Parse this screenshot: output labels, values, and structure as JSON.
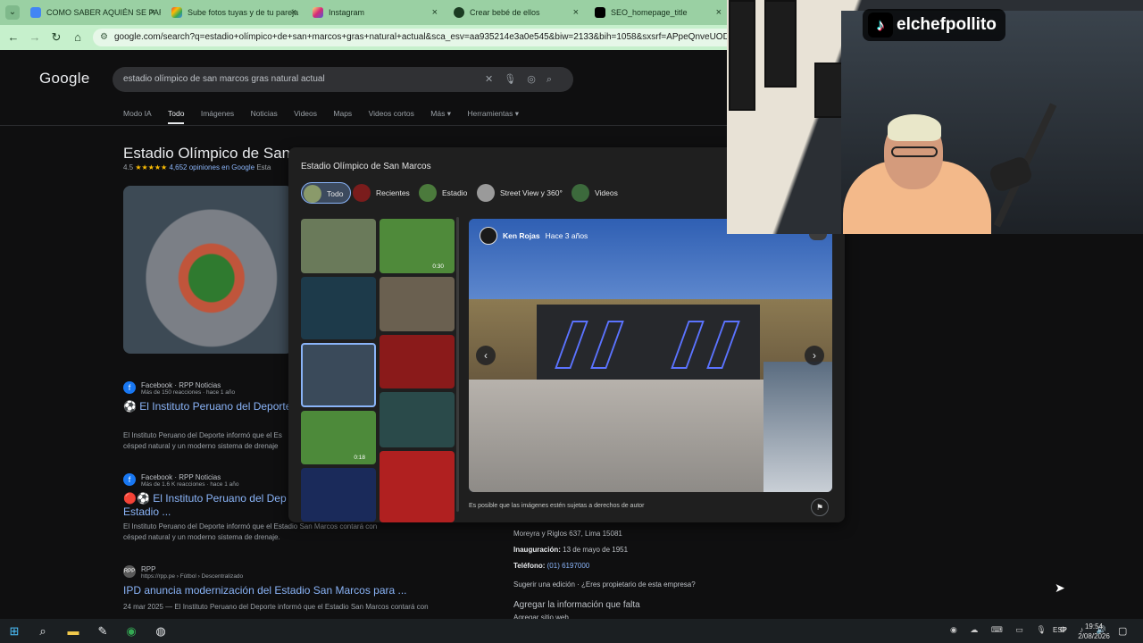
{
  "browser": {
    "tabs": [
      {
        "title": "COMO SABER AQUIÉN SE PAR",
        "favicon": "google-icon",
        "active": false
      },
      {
        "title": "Sube fotos tuyas y de tu pareja",
        "favicon": "gemini-icon",
        "active": false
      },
      {
        "title": "Instagram",
        "favicon": "instagram-icon",
        "active": false
      },
      {
        "title": "Crear bebé de ellos",
        "favicon": "chatgpt-icon",
        "active": false
      },
      {
        "title": "SEO_homepage_title",
        "favicon": "tiktok-icon",
        "active": false
      }
    ],
    "close_glyph": "×",
    "url": "google.com/search?q=estadio+olímpico+de+san+marcos+gras+natural+actual&sca_esv=aa935214e3a0e545&biw=2133&bih=1058&sxsrf=APpeQnveUODh1GHtzM"
  },
  "google": {
    "logo": "Google",
    "query": "estadio olímpico de san marcos gras natural actual",
    "nav": [
      "Modo IA",
      "Todo",
      "Imágenes",
      "Noticias",
      "Videos",
      "Maps",
      "Videos cortos",
      "Más ▾",
      "Herramientas ▾"
    ],
    "active_nav": "Todo",
    "kp_title": "Estadio Olímpico de San",
    "kp_rating_value": "4.5",
    "kp_stars": "★★★★★",
    "kp_reviews": "4,652 opiniones en Google",
    "kp_type": "Esta",
    "results": [
      {
        "icon": "f",
        "source": "Facebook · RPP Noticias",
        "meta": "Más de 150 reacciones · hace 1 año",
        "title": "⚽ El Instituto Peruano del Deporte",
        "snippet_1": "El Instituto Peruano del Deporte informó que el Es",
        "snippet_2": "césped natural y un moderno sistema de drenaje"
      },
      {
        "icon": "f",
        "source": "Facebook · RPP Noticias",
        "meta": "Más de 1.6 K reacciones · hace 1 año",
        "title": "🔴⚽ El Instituto Peruano del Dep",
        "title_2": "Estadio ...",
        "snippet_1": "El Instituto Peruano del Deporte informó que el Estadio San Marcos contará con",
        "snippet_2": "césped natural y un moderno sistema de drenaje."
      },
      {
        "icon": "RPP",
        "source": "RPP",
        "meta": "https://rpp.pe › Fútbol › Descentralizado",
        "title": "IPD anuncia modernización del Estadio San Marcos para ...",
        "snippet_1": "24 mar 2025 — El Instituto Peruano del Deporte informó que el Estadio San Marcos contará con"
      }
    ],
    "info": {
      "address": "Moreyra y Riglos 637, Lima 15081",
      "inauguration_label": "Inauguración:",
      "inauguration_value": "13 de mayo de 1951",
      "phone_label": "Teléfono:",
      "phone_value": "(01) 6197000",
      "suggest": "Sugerir una edición · ¿Eres propietario de esta empresa?",
      "missing": "Agregar la información que falta",
      "add_site": "Agregar sitio web"
    }
  },
  "viewer": {
    "title": "Estadio Olímpico de San Marcos",
    "chips": [
      {
        "label": "Todo",
        "active": true,
        "thumb_color": "#8a9a6a"
      },
      {
        "label": "Recientes",
        "active": false,
        "thumb_color": "#7a1c1c"
      },
      {
        "label": "Estadio",
        "active": false,
        "thumb_color": "#4b7a3c"
      },
      {
        "label": "Street View y 360°",
        "active": false,
        "thumb_color": "#9a9a9a"
      },
      {
        "label": "Videos",
        "active": false,
        "thumb_color": "#3c6a3c"
      }
    ],
    "thumbs_left": [
      {
        "color": "#6a7a5a",
        "duration": ""
      },
      {
        "color": "#1d3a4a",
        "duration": ""
      },
      {
        "color": "#3a4a5a",
        "duration": "",
        "selected": true
      },
      {
        "color": "#4d8a3a",
        "duration": "0:18"
      },
      {
        "color": "#1a2a5a",
        "duration": ""
      }
    ],
    "thumbs_right": [
      {
        "color": "#4f8a3a",
        "duration": "0:30"
      },
      {
        "color": "#6a6050",
        "duration": ""
      },
      {
        "color": "#8a1a1a",
        "duration": ""
      },
      {
        "color": "#2a4a4a",
        "duration": ""
      },
      {
        "color": "#b02020",
        "duration": ""
      }
    ],
    "author": "Ken Rojas",
    "time_ago": "Hace 3 años",
    "copyright": "Es posible que las imágenes estén sujetas a derechos de autor"
  },
  "stream": {
    "handle": "elchefpollito"
  },
  "taskbar": {
    "lang": "ESP",
    "time": "19:54",
    "date": "2/08/2026"
  }
}
